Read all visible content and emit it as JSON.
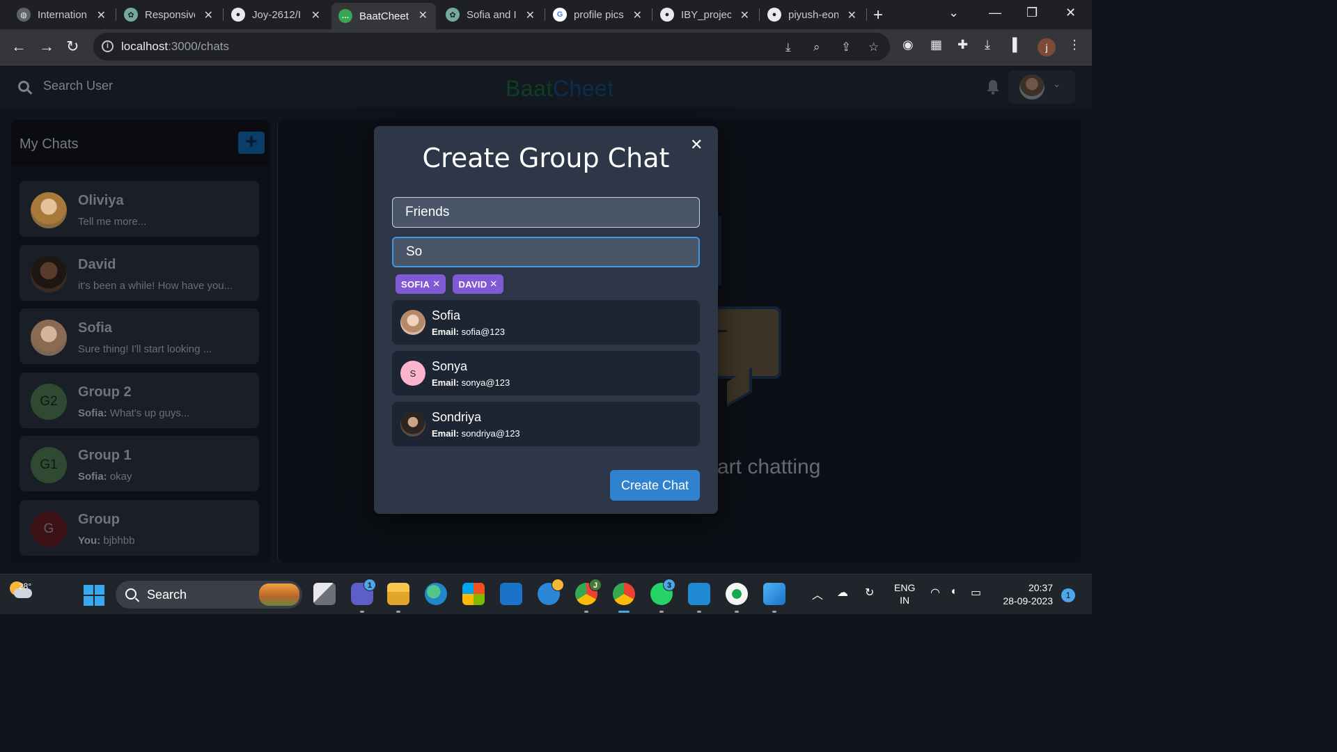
{
  "browser": {
    "tabs": [
      {
        "title": "Internation",
        "favicon": "globe-icon",
        "color": "#9aa0a6"
      },
      {
        "title": "Responsive",
        "favicon": "chatgpt-icon",
        "color": "#74aa9c"
      },
      {
        "title": "Joy-2612/I",
        "favicon": "github-icon",
        "color": "#e8eaed"
      },
      {
        "title": "BaatCheet",
        "favicon": "chat-icon",
        "color": "#34a853",
        "active": true
      },
      {
        "title": "Sofia and I",
        "favicon": "chatgpt-icon",
        "color": "#74aa9c"
      },
      {
        "title": "profile pics",
        "favicon": "google-icon",
        "color": "#ea4335"
      },
      {
        "title": "IBY_project",
        "favicon": "github-icon",
        "color": "#e8eaed"
      },
      {
        "title": "piyush-eon",
        "favicon": "github-icon",
        "color": "#e8eaed"
      }
    ],
    "url_host": "localhost",
    "url_path": ":3000/chats",
    "profile_initial": "j"
  },
  "header": {
    "search_label": "Search User",
    "brand_part1": "Baat",
    "brand_part2": "Cheet"
  },
  "sidebar": {
    "title": "My Chats",
    "add_label": "+",
    "chats": [
      {
        "name": "Oliviya",
        "sender": "",
        "message": "Tell me more...",
        "initials": "",
        "avatar_color": "#8a6a3c"
      },
      {
        "name": "David",
        "sender": "",
        "message": "it's been a while! How have you...",
        "initials": "",
        "avatar_color": "#3a2a22"
      },
      {
        "name": "Sofia",
        "sender": "",
        "message": "Sure thing! I'll start looking ...",
        "initials": "",
        "avatar_color": "#7a6656"
      },
      {
        "name": "Group 2",
        "sender": "Sofia:",
        "message": " What's up guys...",
        "initials": "G2",
        "avatar_color": "#2f4a33"
      },
      {
        "name": "Group 1",
        "sender": "Sofia:",
        "message": " okay",
        "initials": "G1",
        "avatar_color": "#2f4a33"
      },
      {
        "name": "Group",
        "sender": "You:",
        "message": " bjbhbb",
        "initials": "G",
        "avatar_color": "#3d1216"
      }
    ]
  },
  "chat_area": {
    "placeholder_text": "art chatting"
  },
  "modal": {
    "title": "Create Group Chat",
    "close_label": "✕",
    "group_name_value": "Friends",
    "search_value": "So",
    "selected_tags": [
      "SOFIA",
      "DAVID"
    ],
    "tag_remove_label": "✕",
    "results": [
      {
        "name": "Sofia",
        "email_label": "Email:",
        "email": " sofia@123",
        "initial": "",
        "avatar_color": "#d9b9a3"
      },
      {
        "name": "Sonya",
        "email_label": "Email:",
        "email": " sonya@123",
        "initial": "S",
        "avatar_color": "#fbb6ce"
      },
      {
        "name": "Sondriya",
        "email_label": "Email:",
        "email": " sondriya@123",
        "initial": "",
        "avatar_color": "#5a4a40"
      }
    ],
    "submit_label": "Create Chat"
  },
  "taskbar": {
    "temperature": "28°",
    "search_label": "Search",
    "teams_badge": "1",
    "chrome_badge": "J",
    "whatsapp_badge": "3",
    "lang_line1": "ENG",
    "lang_line2": "IN",
    "time": "20:37",
    "date": "28-09-2023",
    "notification_count": "1"
  },
  "colors": {
    "modal_bg": "#2d3748",
    "tag_purple": "#805ad5",
    "button_blue": "#3182ce",
    "focus_blue": "#4299e1"
  }
}
